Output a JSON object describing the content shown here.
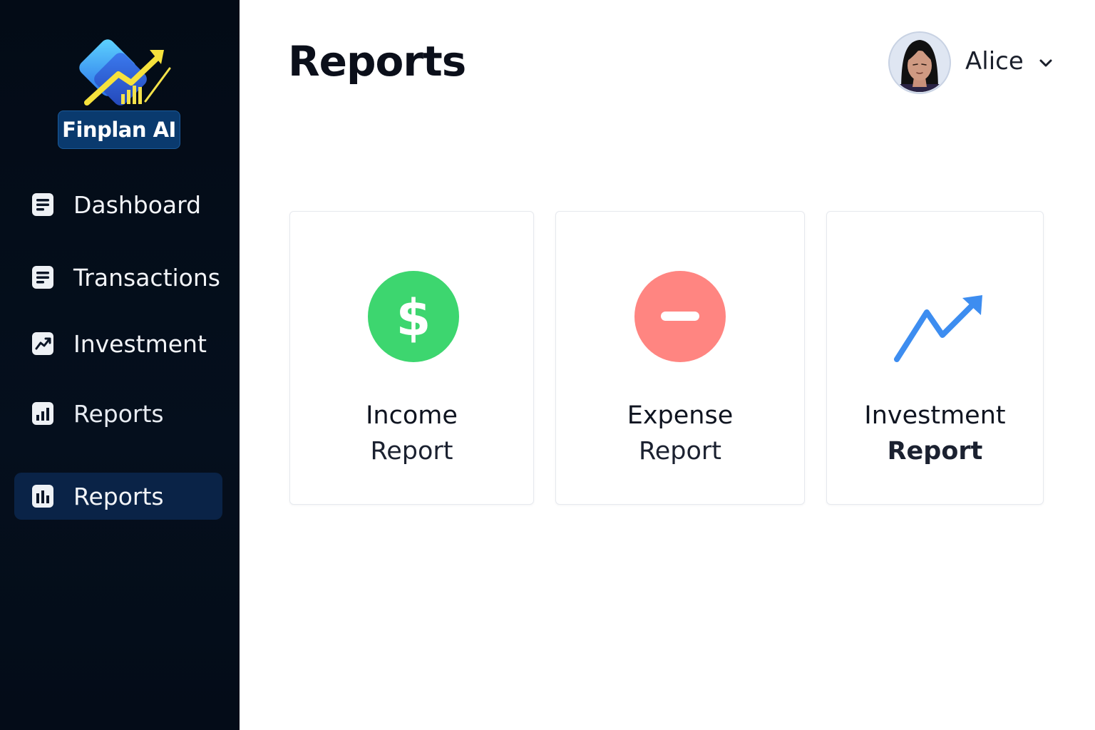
{
  "app": {
    "brand_name": "Finplan AI"
  },
  "sidebar": {
    "items": [
      {
        "label": "Dashboard",
        "icon": "document-icon",
        "active": false
      },
      {
        "label": "Transactions",
        "icon": "document-icon",
        "active": false
      },
      {
        "label": "Investment",
        "icon": "trend-up-icon",
        "active": false
      },
      {
        "label": "Reports",
        "icon": "bar-chart-icon",
        "active": false
      },
      {
        "label": "Reports",
        "icon": "bar-chart-icon",
        "active": true
      }
    ]
  },
  "header": {
    "title": "Reports",
    "user": {
      "name": "Alice",
      "avatar_icon": "avatar-icon",
      "menu_icon": "chevron-down-icon"
    }
  },
  "cards": [
    {
      "line1": "Income",
      "line2": "Report",
      "icon": "dollar-icon",
      "color": "#3dd66f"
    },
    {
      "line1": "Expense",
      "line2": "Report",
      "icon": "minus-icon",
      "color": "#ff8581"
    },
    {
      "line1": "Investment",
      "line2": "Report",
      "icon": "trend-up-arrow-icon",
      "color": "#3d8df0"
    }
  ],
  "colors": {
    "sidebar_bg": "#030b16",
    "active_item_bg": "#0a2347",
    "brand_badge": "#0a3a6e",
    "income_green": "#3dd66f",
    "expense_red": "#ff8581",
    "investment_blue": "#3d8df0"
  }
}
